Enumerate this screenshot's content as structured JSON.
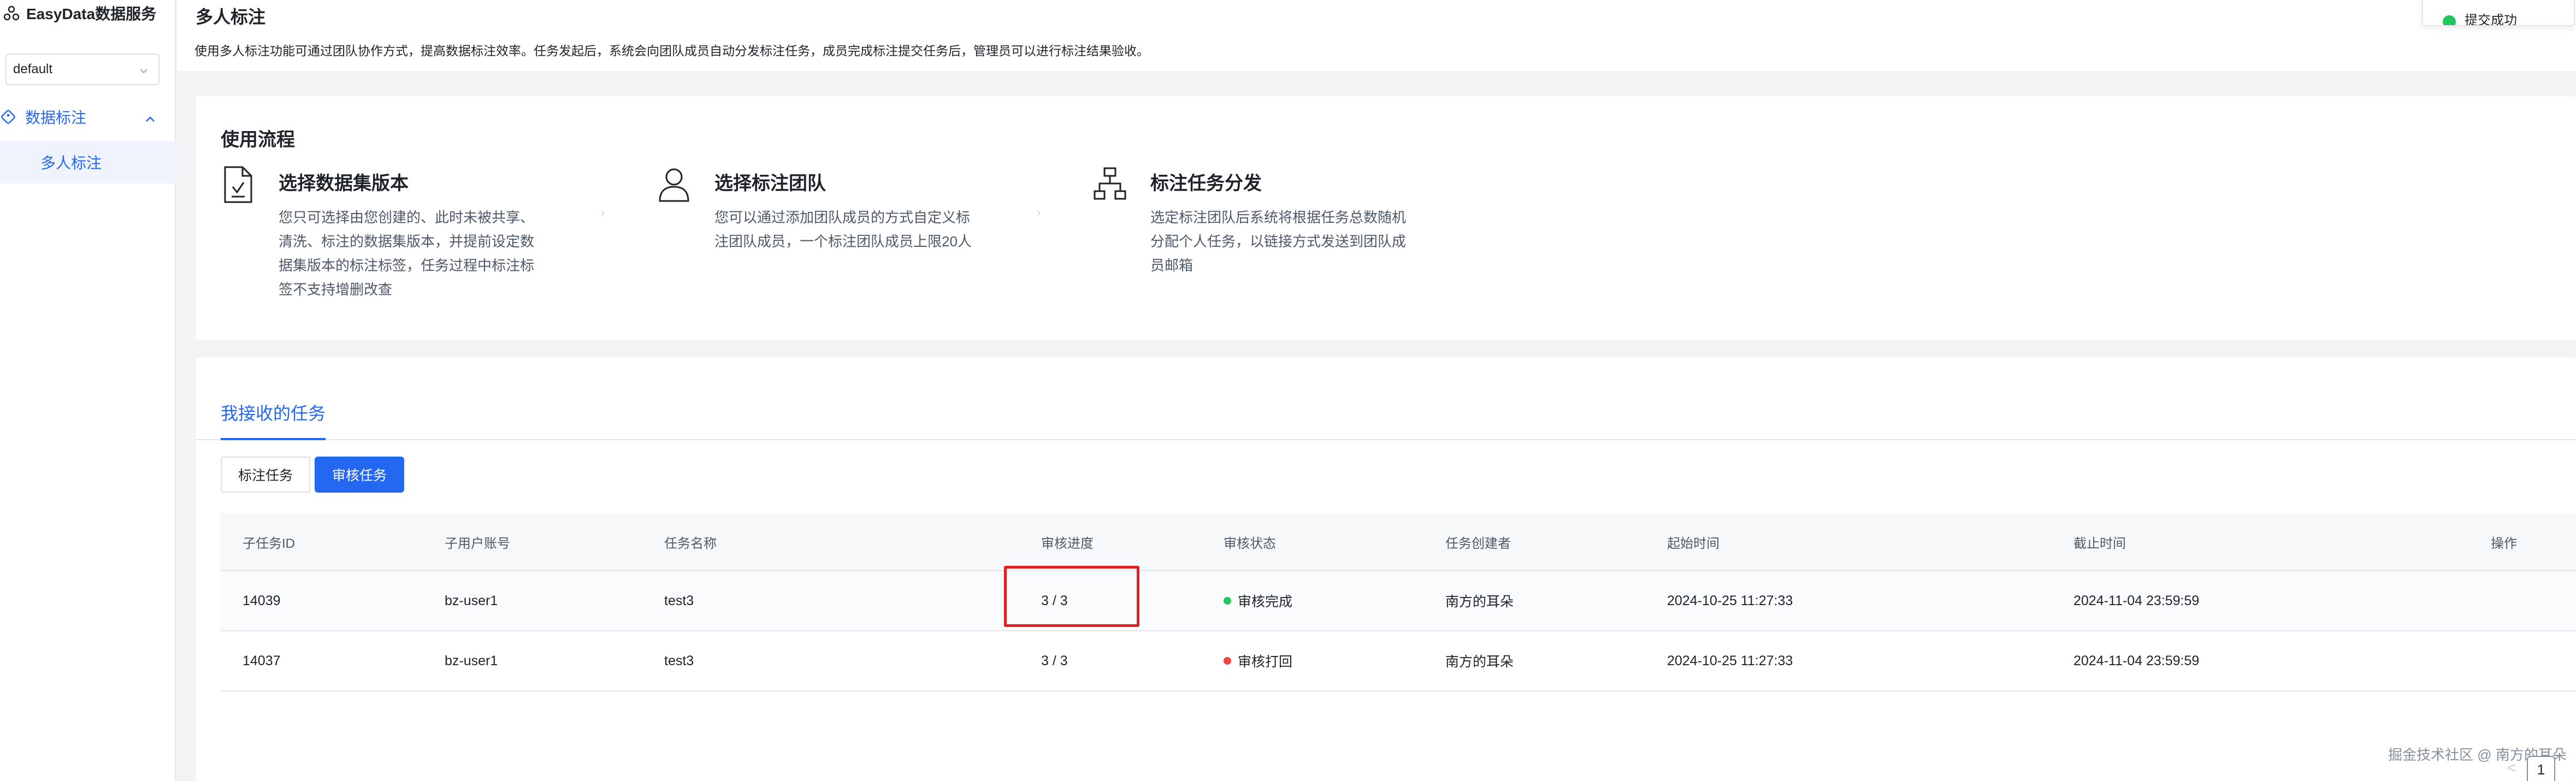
{
  "sidebar": {
    "brand": "EasyData数据服务",
    "env_select": "default",
    "menu_group": "数据标注",
    "menu_item": "多人标注"
  },
  "header": {
    "title": "多人标注",
    "description": "使用多人标注功能可通过团队协作方式，提高数据标注效率。任务发起后，系统会向团队成员自动分发标注任务，成员完成标注提交任务后，管理员可以进行标注结果验收。",
    "toast": "提交成功"
  },
  "flow": {
    "title": "使用流程",
    "steps": [
      {
        "name": "选择数据集版本",
        "desc": "您只可选择由您创建的、此时未被共享、清洗、标注的数据集版本，并提前设定数据集版本的标注标签，任务过程中标注标签不支持增删改查",
        "icon": "document-check-icon"
      },
      {
        "name": "选择标注团队",
        "desc": "您可以通过添加团队成员的方式自定义标注团队成员，一个标注团队成员上限20人",
        "icon": "user-icon"
      },
      {
        "name": "标注任务分发",
        "desc": "选定标注团队后系统将根据任务总数随机分配个人任务，以链接方式发送到团队成员邮箱",
        "icon": "org-chart-icon"
      }
    ]
  },
  "tasks": {
    "tab": "我接收的任务",
    "segments": [
      "标注任务",
      "审核任务"
    ],
    "columns": [
      "子任务ID",
      "子用户账号",
      "任务名称",
      "审核进度",
      "审核状态",
      "任务创建者",
      "起始时间",
      "截止时间",
      "操作"
    ],
    "rows": [
      {
        "id": "14039",
        "account": "bz-user1",
        "name": "test3",
        "progress": "3 / 3",
        "status": "审核完成",
        "status_color": "#22c55e",
        "creator": "南方的耳朵",
        "start": "2024-10-25 11:27:33",
        "end": "2024-11-04 23:59:59"
      },
      {
        "id": "14037",
        "account": "bz-user1",
        "name": "test3",
        "progress": "3 / 3",
        "status": "审核打回",
        "status_color": "#ef4444",
        "creator": "南方的耳朵",
        "start": "2024-10-25 11:27:33",
        "end": "2024-11-04 23:59:59"
      }
    ]
  },
  "footer": {
    "watermark": "掘金技术社区 @ 南方的耳朵",
    "page": "1",
    "prev": "<"
  },
  "colors": {
    "accent": "#2468f2",
    "highlight_box": "#e02020"
  }
}
